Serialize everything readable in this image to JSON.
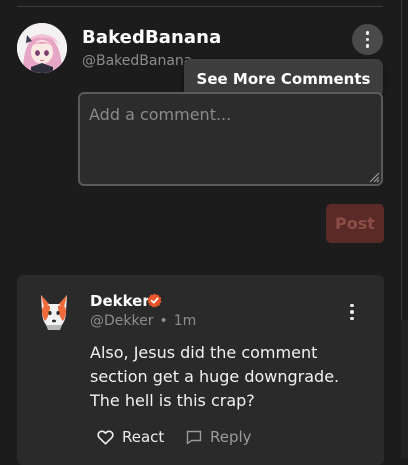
{
  "composer": {
    "username": "BakedBanana",
    "handle": "@BakedBanana",
    "menu_item": "See More Comments",
    "placeholder": "Add a comment...",
    "post_label": "Post"
  },
  "comment": {
    "author": "Dekker",
    "handle": "@Dekker",
    "separator": "•",
    "time": "1m",
    "body": "Also, Jesus did the comment section get a huge downgrade. The hell is this crap?",
    "react_label": "React",
    "reply_label": "Reply"
  },
  "colors": {
    "background": "#1c1c1c",
    "card": "#2a2a2a",
    "post_button": "#5a2a26",
    "verified": "#e8562a"
  },
  "icons": [
    "kebab-menu-icon",
    "heart-icon",
    "reply-icon",
    "verified-badge-icon"
  ]
}
